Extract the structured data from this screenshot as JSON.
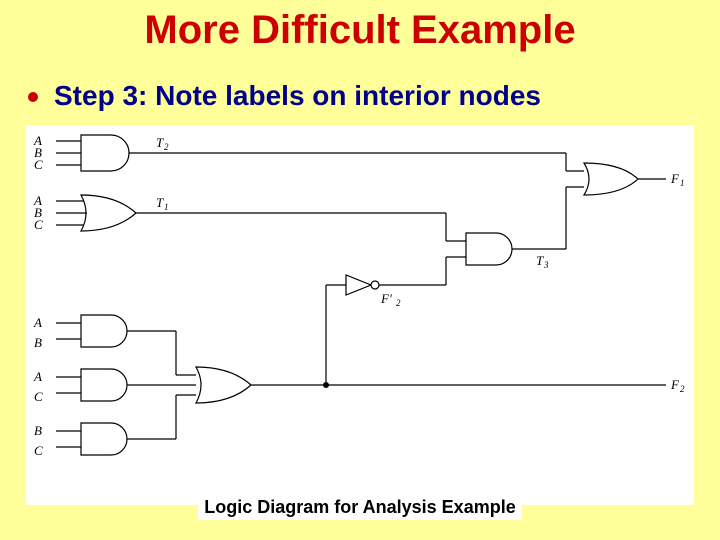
{
  "title": "More Difficult Example",
  "bullet": "Step 3: Note labels on interior nodes",
  "caption": "Logic Diagram for Analysis Example",
  "labels": {
    "A": "A",
    "B": "B",
    "C": "C",
    "T1": "T",
    "T1s": "1",
    "T2": "T",
    "T2s": "2",
    "T3": "T",
    "T3s": "3",
    "F1": "F",
    "F1s": "1",
    "F2": "F",
    "F2s": "2",
    "F2p": "F'",
    "F2ps": "2"
  },
  "chart_data": {
    "type": "logic_diagram",
    "inputs": [
      "A",
      "B",
      "C"
    ],
    "outputs": [
      "F1",
      "F2"
    ],
    "gates": [
      {
        "id": "G1",
        "type": "AND3",
        "inputs": [
          "A",
          "B",
          "C"
        ],
        "output": "T2"
      },
      {
        "id": "G2",
        "type": "OR3",
        "inputs": [
          "A",
          "B",
          "C"
        ],
        "output": "T1"
      },
      {
        "id": "G3",
        "type": "AND2",
        "inputs": [
          "A",
          "B"
        ],
        "output": "n1"
      },
      {
        "id": "G4",
        "type": "AND2",
        "inputs": [
          "A",
          "C"
        ],
        "output": "n2"
      },
      {
        "id": "G5",
        "type": "AND2",
        "inputs": [
          "B",
          "C"
        ],
        "output": "n3"
      },
      {
        "id": "G6",
        "type": "OR3",
        "inputs": [
          "n1",
          "n2",
          "n3"
        ],
        "output": "F2"
      },
      {
        "id": "G7",
        "type": "NOT",
        "inputs": [
          "F2"
        ],
        "output": "F2'"
      },
      {
        "id": "G8",
        "type": "AND2",
        "inputs": [
          "T1",
          "F2'"
        ],
        "output": "T3"
      },
      {
        "id": "G9",
        "type": "OR2",
        "inputs": [
          "T2",
          "T3"
        ],
        "output": "F1"
      }
    ]
  }
}
